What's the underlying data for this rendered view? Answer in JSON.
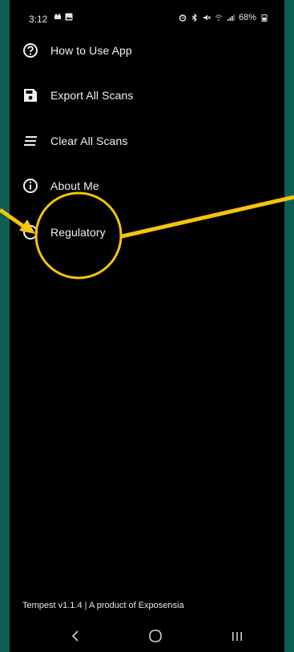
{
  "status_bar": {
    "time": "3:12",
    "battery": "68%"
  },
  "drawer": {
    "items": [
      {
        "label": "How to Use App",
        "icon": "help-circle-icon"
      },
      {
        "label": "Export All Scans",
        "icon": "save-icon"
      },
      {
        "label": "Clear All Scans",
        "icon": "clear-list-icon"
      },
      {
        "label": "About Me",
        "icon": "info-circle-icon"
      },
      {
        "label": "Regulatory",
        "icon": "regulatory-icon"
      }
    ]
  },
  "footer": {
    "text": "Tempest v1.1.4 | A product of Exposensia"
  },
  "colors": {
    "background": "#000000",
    "frame": "#0b5f55",
    "annotation": "#f4c40f",
    "text": "#f1f1f1"
  }
}
